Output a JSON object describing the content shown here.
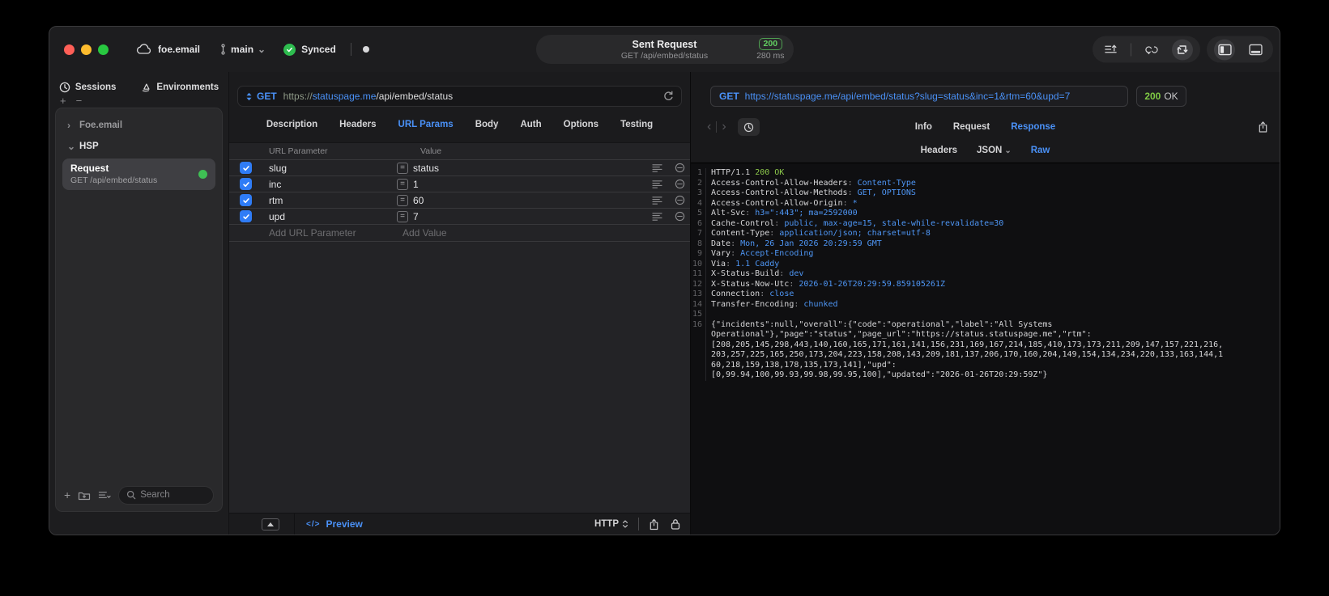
{
  "titlebar": {
    "project": "foe.email",
    "branch": "main",
    "sync_status": "Synced",
    "request_title": "Sent Request",
    "request_subtitle": "GET /api/embed/status",
    "status_code": "200",
    "duration": "280 ms"
  },
  "sidebar": {
    "tabs": [
      {
        "label": "Sessions"
      },
      {
        "label": "Environments"
      }
    ],
    "tree": {
      "group1": "Foe.email",
      "group2": "HSP",
      "request": {
        "title": "Request",
        "subtitle": "GET /api/embed/status"
      }
    },
    "search_placeholder": "Search"
  },
  "request_editor": {
    "method": "GET",
    "url_scheme": "https://",
    "url_host": "statuspage.me",
    "url_path": "/api/embed/status",
    "tabs": [
      "Description",
      "Headers",
      "URL Params",
      "Body",
      "Auth",
      "Options",
      "Testing"
    ],
    "active_tab": "URL Params",
    "param_table": {
      "columns": [
        "URL Parameter",
        "Value"
      ],
      "eq_symbol": "=",
      "rows": [
        {
          "name": "slug",
          "value": "status",
          "enabled": true
        },
        {
          "name": "inc",
          "value": "1",
          "enabled": true
        },
        {
          "name": "rtm",
          "value": "60",
          "enabled": true
        },
        {
          "name": "upd",
          "value": "7",
          "enabled": true
        }
      ],
      "add_name_placeholder": "Add URL Parameter",
      "add_value_placeholder": "Add Value"
    },
    "footer": {
      "code_glyph": "</>",
      "preview_label": "Preview",
      "protocol": "HTTP"
    }
  },
  "response_viewer": {
    "request_line": {
      "method": "GET",
      "url": "https://statuspage.me/api/embed/status?slug=status&inc=1&rtm=60&upd=7"
    },
    "status": {
      "code": "200",
      "text": "OK"
    },
    "tabs": [
      "Info",
      "Request",
      "Response"
    ],
    "active_tab": "Response",
    "subtabs": [
      "Headers",
      "JSON",
      "Raw"
    ],
    "active_subtab": "Raw",
    "lines": [
      {
        "n": "1",
        "segs": [
          [
            "HTTP/1.1 ",
            "w"
          ],
          [
            "200 OK",
            "g"
          ]
        ]
      },
      {
        "n": "2",
        "segs": [
          [
            "Access-Control-Allow-Headers",
            "w"
          ],
          [
            ": ",
            "d"
          ],
          [
            "Content-Type",
            "b"
          ]
        ]
      },
      {
        "n": "3",
        "segs": [
          [
            "Access-Control-Allow-Methods",
            "w"
          ],
          [
            ": ",
            "d"
          ],
          [
            "GET, OPTIONS",
            "b"
          ]
        ]
      },
      {
        "n": "4",
        "segs": [
          [
            "Access-Control-Allow-Origin",
            "w"
          ],
          [
            ": ",
            "d"
          ],
          [
            "*",
            "b"
          ]
        ]
      },
      {
        "n": "5",
        "segs": [
          [
            "Alt-Svc",
            "w"
          ],
          [
            ": ",
            "d"
          ],
          [
            "h3=\":443\"; ma=2592000",
            "b"
          ]
        ]
      },
      {
        "n": "6",
        "segs": [
          [
            "Cache-Control",
            "w"
          ],
          [
            ": ",
            "d"
          ],
          [
            "public, max-age=15, stale-while-revalidate=30",
            "b"
          ]
        ]
      },
      {
        "n": "7",
        "segs": [
          [
            "Content-Type",
            "w"
          ],
          [
            ": ",
            "d"
          ],
          [
            "application/json; charset=utf-8",
            "b"
          ]
        ]
      },
      {
        "n": "8",
        "segs": [
          [
            "Date",
            "w"
          ],
          [
            ": ",
            "d"
          ],
          [
            "Mon, 26 Jan 2026 20:29:59 GMT",
            "b"
          ]
        ]
      },
      {
        "n": "9",
        "segs": [
          [
            "Vary",
            "w"
          ],
          [
            ": ",
            "d"
          ],
          [
            "Accept-Encoding",
            "b"
          ]
        ]
      },
      {
        "n": "10",
        "segs": [
          [
            "Via",
            "w"
          ],
          [
            ": ",
            "d"
          ],
          [
            "1.1 Caddy",
            "b"
          ]
        ]
      },
      {
        "n": "11",
        "segs": [
          [
            "X-Status-Build",
            "w"
          ],
          [
            ": ",
            "d"
          ],
          [
            "dev",
            "b"
          ]
        ]
      },
      {
        "n": "12",
        "segs": [
          [
            "X-Status-Now-Utc",
            "w"
          ],
          [
            ": ",
            "d"
          ],
          [
            "2026-01-26T20:29:59.859105261Z",
            "b"
          ]
        ]
      },
      {
        "n": "13",
        "segs": [
          [
            "Connection",
            "w"
          ],
          [
            ": ",
            "d"
          ],
          [
            "close",
            "b"
          ]
        ]
      },
      {
        "n": "14",
        "segs": [
          [
            "Transfer-Encoding",
            "w"
          ],
          [
            ": ",
            "d"
          ],
          [
            "chunked",
            "b"
          ]
        ]
      },
      {
        "n": "15",
        "segs": []
      },
      {
        "n": "16",
        "segs": [
          [
            "{\"incidents\":null,\"overall\":{\"code\":\"operational\",\"label\":\"All Systems",
            "w"
          ]
        ]
      },
      {
        "n": "",
        "segs": [
          [
            "Operational\"},\"page\":\"status\",\"page_url\":\"https://status.statuspage.me\",\"rtm\":",
            "w"
          ]
        ]
      },
      {
        "n": "",
        "segs": [
          [
            "[208,205,145,298,443,140,160,165,171,161,141,156,231,169,167,214,185,410,173,173,211,209,147,157,221,216,",
            "w"
          ]
        ]
      },
      {
        "n": "",
        "segs": [
          [
            "203,257,225,165,250,173,204,223,158,208,143,209,181,137,206,170,160,204,149,154,134,234,220,133,163,144,1",
            "w"
          ]
        ]
      },
      {
        "n": "",
        "segs": [
          [
            "60,218,159,138,178,135,173,141],\"upd\":",
            "w"
          ]
        ]
      },
      {
        "n": "",
        "segs": [
          [
            "[0,99.94,100,99.93,99.98,99.95,100],\"updated\":\"2026-01-26T20:29:59Z\"}",
            "w"
          ]
        ]
      }
    ]
  },
  "colors": {
    "accent_blue": "#4A91F7",
    "header_value_blue": "#4E96F5",
    "ok_green": "#8CC84B",
    "badge_green": "#62CE62",
    "dot_green": "#3FBF54"
  }
}
